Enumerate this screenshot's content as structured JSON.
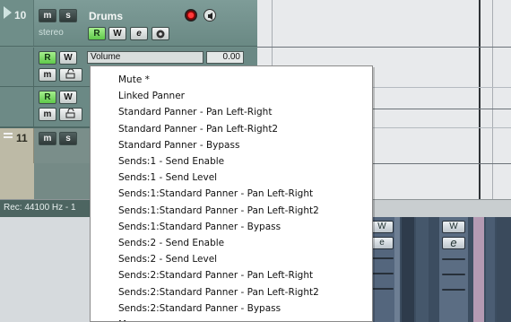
{
  "track10": {
    "number": "10",
    "name": "Drums",
    "channel_type": "stereo",
    "mute_label": "m",
    "solo_label": "s",
    "read_label": "R",
    "write_label": "W",
    "edit_label": "e",
    "record_icon": "record-enable-icon",
    "monitor_icon": "monitor-icon"
  },
  "automation_lane": {
    "read_label": "R",
    "write_label": "W",
    "parameter": "Volume",
    "value": "0.00",
    "mute_label": "m"
  },
  "automation_lane2": {
    "read_label": "R",
    "write_label": "W",
    "mute_label": "m"
  },
  "track11": {
    "number": "11",
    "mute_label": "m",
    "solo_label": "s"
  },
  "status": {
    "record_format": "Rec: 44100 Hz - 1"
  },
  "mixer": {
    "write_label": "W",
    "edit_label": "e"
  },
  "context_menu": {
    "items": [
      "Mute *",
      "Linked Panner",
      "Standard Panner - Pan Left-Right",
      "Standard Panner - Pan Left-Right2",
      "Standard Panner - Bypass",
      "Sends:1 - Send Enable",
      "Sends:1 - Send Level",
      "Sends:1:Standard Panner - Pan Left-Right",
      "Sends:1:Standard Panner - Pan Left-Right2",
      "Sends:1:Standard Panner - Bypass",
      "Sends:2 - Send Enable",
      "Sends:2 - Send Level",
      "Sends:2:Standard Panner - Pan Left-Right",
      "Sends:2:Standard Panner - Pan Left-Right2",
      "Sends:2:Standard Panner - Bypass",
      "M..."
    ]
  }
}
